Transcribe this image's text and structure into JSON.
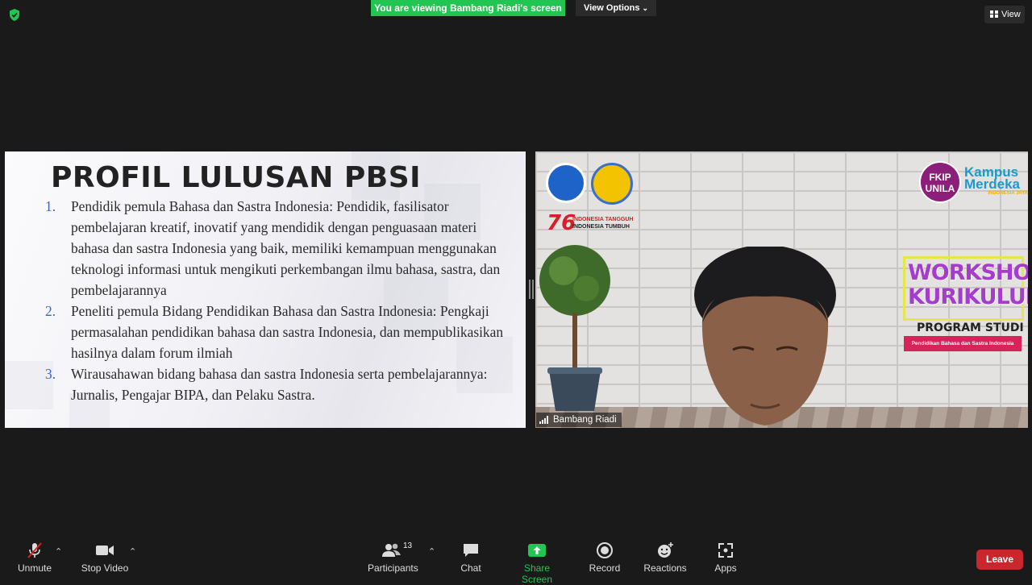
{
  "top": {
    "banner": "You are viewing Bambang Riadi's screen",
    "view_options": "View Options",
    "view": "View"
  },
  "slide": {
    "title": "PROFIL LULUSAN PBSI",
    "items": [
      {
        "num": "1.",
        "text": "Pendidik pemula Bahasa dan Sastra Indonesia: Pendidik, fasilisator pembelajaran kreatif, inovatif yang mendidik dengan penguasaan materi bahasa dan sastra Indonesia yang baik, memiliki kemampuan menggunakan teknologi informasi untuk mengikuti perkembangan ilmu bahasa, sastra, dan pembelajarannya"
      },
      {
        "num": "2.",
        "text": "Peneliti pemula Bidang Pendidikan Bahasa dan Sastra Indonesia: Pengkaji permasalahan pendidikan bahasa dan sastra Indonesia, dan mempublikasikan hasilnya dalam forum ilmiah"
      },
      {
        "num": "3.",
        "text": "Wirausahawan bidang bahasa dan sastra Indonesia serta pembelajarannya: Jurnalis, Pengajar BIPA, dan Pelaku Sastra."
      }
    ]
  },
  "video": {
    "participant_name": "Bambang Riadi",
    "background": {
      "anniversary": "76",
      "tagline_red": "INDONESIA TANGGUH",
      "tagline_black": "INDONESIA TUMBUH",
      "fkip_logo": "FKIP UNILA",
      "km_logo": "Kampus Merdeka",
      "km_sub": "INDONESIA JAYA",
      "workshop_line1": "WORKSHOP",
      "workshop_line2": "KURIKULUM",
      "program": "PROGRAM STUDI",
      "program_name": "Pendidikan Bahasa dan Sastra Indonesia"
    }
  },
  "toolbar": {
    "unmute": "Unmute",
    "stop_video": "Stop Video",
    "participants": "Participants",
    "participant_count": "13",
    "chat": "Chat",
    "share_screen": "Share Screen",
    "record": "Record",
    "reactions": "Reactions",
    "apps": "Apps",
    "leave": "Leave"
  },
  "colors": {
    "accent_green": "#23c552",
    "leave_red": "#c8282c",
    "slide_number_blue": "#3a64c8"
  },
  "icons": [
    "shield-icon",
    "grid-icon",
    "chevron-down-icon",
    "microphone-muted-icon",
    "video-camera-icon",
    "participants-icon",
    "chat-icon",
    "share-screen-icon",
    "record-icon",
    "reactions-icon",
    "apps-icon",
    "signal-icon"
  ]
}
